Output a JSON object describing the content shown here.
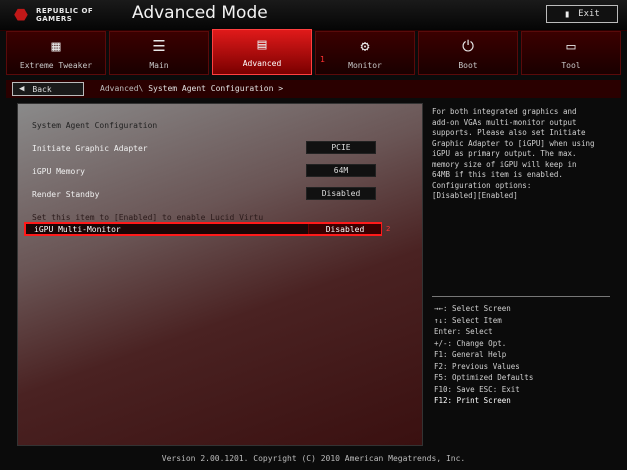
{
  "header": {
    "brand_line1": "REPUBLIC OF",
    "brand_line2": "GAMERS",
    "mode_title": "Advanced Mode",
    "exit_label": "Exit"
  },
  "tabs": [
    {
      "label": "Extreme Tweaker",
      "icon": "cpu-cooler-icon"
    },
    {
      "label": "Main",
      "icon": "list-icon"
    },
    {
      "label": "Advanced",
      "icon": "advanced-icon",
      "active": true
    },
    {
      "label": "Monitor",
      "icon": "monitor-icon"
    },
    {
      "label": "Boot",
      "icon": "power-icon"
    },
    {
      "label": "Tool",
      "icon": "tool-icon"
    }
  ],
  "callouts": {
    "one": "1",
    "two": "2"
  },
  "nav": {
    "back_label": "Back",
    "breadcrumb_parent": "Advanced\\",
    "breadcrumb_current": "System Agent Configuration >"
  },
  "settings": {
    "section_title": "System Agent Configuration",
    "rows": [
      {
        "label": "Initiate Graphic Adapter",
        "value": "PCIE"
      },
      {
        "label": "iGPU Memory",
        "value": "64M"
      },
      {
        "label": "Render Standby",
        "value": "Disabled"
      }
    ],
    "hint": "Set this item to [Enabled] to enable Lucid Virtu",
    "selected": {
      "label": "iGPU Multi-Monitor",
      "value": "Disabled"
    }
  },
  "help": {
    "description": "For both integrated graphics and\nadd-on VGAs multi-monitor output\nsupports. Please also set Initiate\nGraphic Adapter to [iGPU] when using\niGPU as primary output. The max.\nmemory size of iGPU will keep in\n64MB if this item is enabled.\nConfiguration options:\n[Disabled][Enabled]",
    "keys": [
      "→←: Select Screen",
      "↑↓: Select Item",
      "Enter: Select",
      "+/-: Change Opt.",
      "F1: General Help",
      "F2: Previous Values",
      "F5: Optimized Defaults",
      "F10: Save  ESC: Exit",
      "F12: Print Screen"
    ]
  },
  "footer": {
    "version": "Version 2.00.1201. Copyright (C) 2010 American Megatrends, Inc."
  },
  "colors": {
    "accent": "#e01a1a",
    "highlight_border": "#ff1a1a"
  }
}
